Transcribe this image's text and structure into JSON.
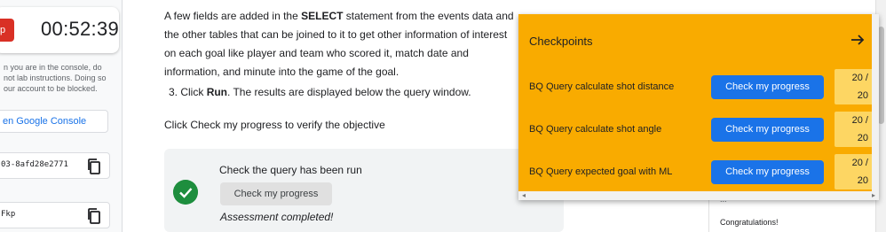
{
  "sidebar": {
    "end_label": "p",
    "timer": "00:52:39",
    "warning": "n you are in the console, do not lab instructions. Doing so our account to be blocked.",
    "open_console": "en Google Console",
    "credentials": [
      {
        "value": "03-8afd28e2771",
        "copy_icon": "copy-icon"
      },
      {
        "value": "Fkp",
        "copy_icon": "copy-icon"
      }
    ]
  },
  "main": {
    "paragraph_pre": "A few fields are added in the ",
    "paragraph_bold": "SELECT",
    "paragraph_post": " statement from the events data and the other tables that can be joined to it to get other information of interest on each goal like player and team who scored it, match date and information, and minute into the game of the goal.",
    "step_prefix": "3. Click ",
    "step_bold": "Run",
    "step_suffix": ". The results are displayed below the query window.",
    "click_check": "Click Check my progress to verify the objective",
    "assessment": {
      "title": "Check the query has been run",
      "button": "Check my progress",
      "status": "Assessment completed!"
    },
    "right_panel": {
      "dots": "...",
      "congrats": "Congratulations!"
    }
  },
  "checkpoints": {
    "title": "Checkpoints",
    "arrow_icon": "arrow-right-icon",
    "items": [
      {
        "name": "BQ Query calculate shot distance",
        "button": "Check my progress",
        "score_a": "20 /",
        "score_b": "20"
      },
      {
        "name": "BQ Query calculate shot angle",
        "button": "Check my progress",
        "score_a": "20 /",
        "score_b": "20"
      },
      {
        "name": "BQ Query expected goal with ML",
        "button": "Check my progress",
        "score_a": "20 /",
        "score_b": "20"
      }
    ]
  },
  "colors": {
    "checkpoint_bg": "#f9ab00",
    "score_bg": "#fdd663",
    "primary_button": "#1a73e8",
    "success": "#1e8e3e",
    "danger": "#d93025"
  }
}
